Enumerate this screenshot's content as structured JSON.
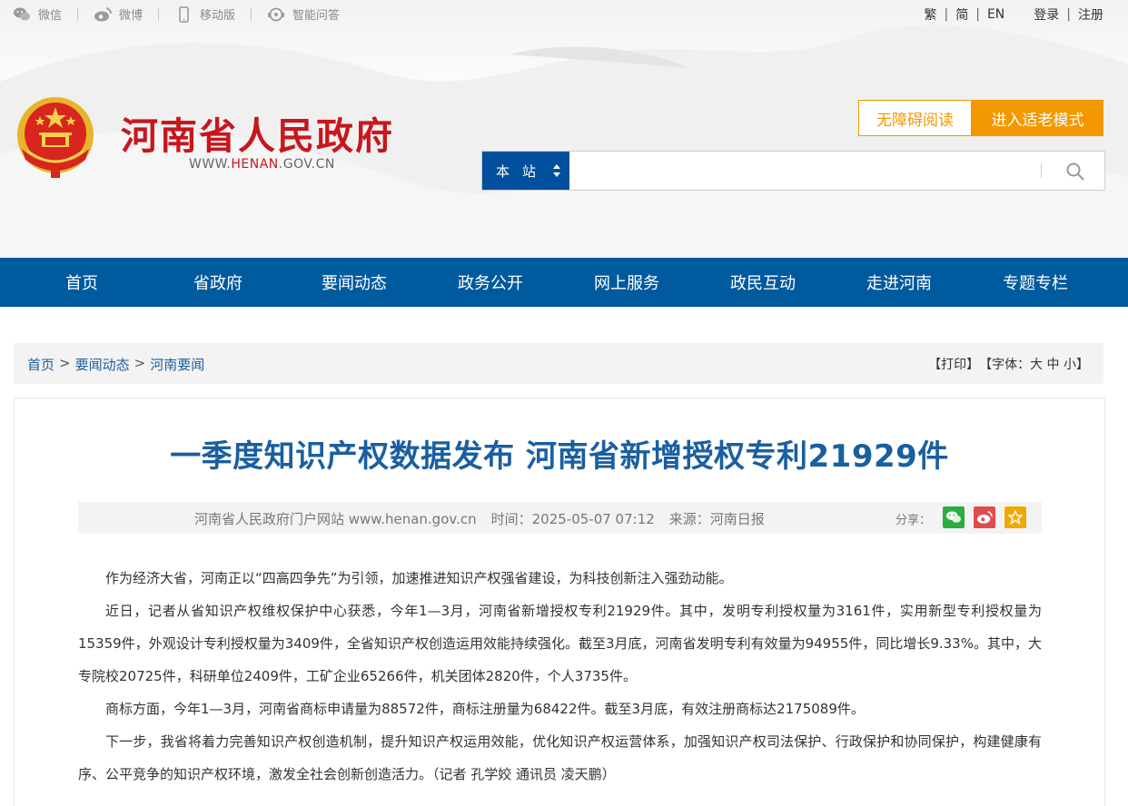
{
  "topbar": {
    "wechat": "微信",
    "weibo": "微博",
    "mobile": "移动版",
    "qa": "智能问答",
    "lang_trad": "繁",
    "lang_simp": "简",
    "lang_en": "EN",
    "login": "登录",
    "register": "注册",
    "bar": "|"
  },
  "logo": {
    "title": "河南省人民政府",
    "url_prefix": "WWW.",
    "url_highlight": "HENAN",
    "url_suffix": ".GOV.CN"
  },
  "actions": {
    "accessible": "无障碍阅读",
    "elder_mode": "进入适老模式"
  },
  "search": {
    "scope": "本站",
    "placeholder": ""
  },
  "nav": [
    "首页",
    "省政府",
    "要闻动态",
    "政务公开",
    "网上服务",
    "政民互动",
    "走进河南",
    "专题专栏"
  ],
  "breadcrumb": {
    "items": [
      "首页",
      "要闻动态",
      "河南要闻"
    ],
    "sep": ">",
    "print": "【打印】",
    "font_prefix": "【字体：",
    "font_large": "大",
    "font_medium": "中",
    "font_small": "小",
    "font_suffix": "】"
  },
  "article": {
    "title": "一季度知识产权数据发布 河南省新增授权专利21929件",
    "site": "河南省人民政府门户网站 www.henan.gov.cn",
    "time": "时间：2025-05-07 07:12",
    "source": "来源：河南日报",
    "share_label": "分享：",
    "paragraphs": [
      "作为经济大省，河南正以“四高四争先”为引领，加速推进知识产权强省建设，为科技创新注入强劲动能。",
      "近日，记者从省知识产权维权保护中心获悉，今年1—3月，河南省新增授权专利21929件。其中，发明专利授权量为3161件，实用新型专利授权量为15359件，外观设计专利授权量为3409件，全省知识产权创造运用效能持续强化。截至3月底，河南省发明专利有效量为94955件，同比增长9.33%。其中，大专院校20725件，科研单位2409件，工矿企业65266件，机关团体2820件，个人3735件。",
      "商标方面，今年1—3月，河南省商标申请量为88572件，商标注册量为68422件。截至3月底，有效注册商标达2175089件。",
      "下一步，我省将着力完善知识产权创造机制，提升知识产权运用效能，优化知识产权运营体系，加强知识产权司法保护、行政保护和协同保护，构建健康有序、公平竞争的知识产权环境，激发全社会创新创造活力。（记者 孔学姣 通讯员 凌天鹏）"
    ]
  },
  "colors": {
    "brand_red": "#c8161d",
    "nav_blue": "#005a9e",
    "accent_orange": "#f39800",
    "title_blue": "#1a5fa0"
  },
  "icons": [
    "wechat-icon",
    "weibo-icon",
    "mobile-icon",
    "chat-icon",
    "search-icon",
    "emblem-icon",
    "star-icon"
  ]
}
